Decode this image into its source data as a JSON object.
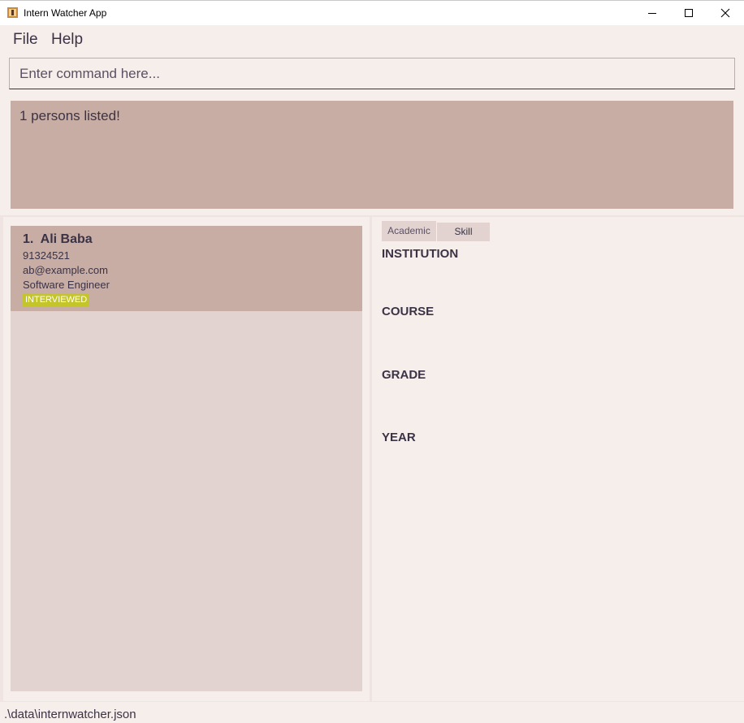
{
  "window": {
    "title": "Intern Watcher App",
    "app_icon": "app-icon"
  },
  "menu": {
    "items": [
      {
        "label": "File"
      },
      {
        "label": "Help"
      }
    ]
  },
  "command": {
    "placeholder": "Enter command here...",
    "value": ""
  },
  "result": {
    "message": "1 persons listed!"
  },
  "persons": [
    {
      "index": "1.",
      "name": "Ali Baba",
      "phone": "91324521",
      "email": "ab@example.com",
      "role": "Software Engineer",
      "status_tag": "INTERVIEWED"
    }
  ],
  "detail": {
    "tabs": [
      {
        "label": "Academic",
        "selected": true
      },
      {
        "label": "Skill",
        "selected": false
      }
    ],
    "fields": [
      {
        "label": "INSTITUTION"
      },
      {
        "label": "COURSE"
      },
      {
        "label": "GRADE"
      },
      {
        "label": "YEAR"
      }
    ]
  },
  "status_bar": {
    "file_path": ".\\data\\internwatcher.json"
  },
  "colors": {
    "background": "#f6eeeb",
    "card": "#c8ada5",
    "list_panel": "#e2d3d0",
    "tag": "#c4c42b",
    "text": "#3b3345"
  }
}
